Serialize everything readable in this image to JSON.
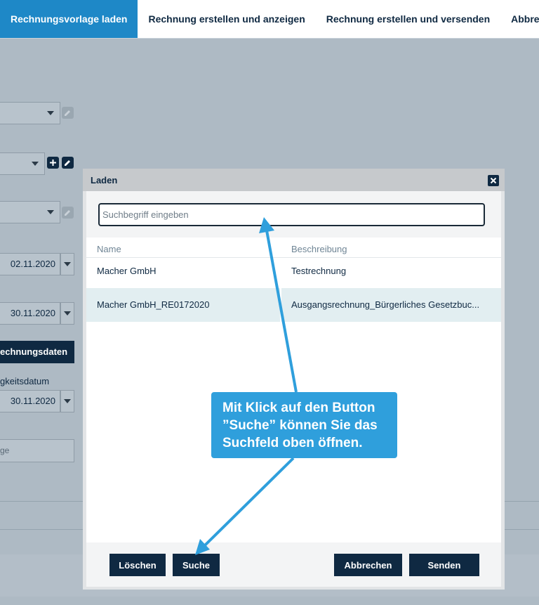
{
  "tabs": [
    {
      "label": "Rechnungsvorlage laden",
      "active": true
    },
    {
      "label": "Rechnung erstellen und anzeigen",
      "active": false
    },
    {
      "label": "Rechnung erstellen und versenden",
      "active": false
    },
    {
      "label": "Abbrechen",
      "active": false
    }
  ],
  "background": {
    "date1": "02.11.2020",
    "date2": "30.11.2020",
    "date3": "30.11.2020",
    "dark_button_label": "echnungsdaten",
    "date_field_label": "gkeitsdatum",
    "input_fragment": "ge"
  },
  "modal": {
    "title": "Laden",
    "search": {
      "placeholder": "Suchbegriff eingeben",
      "value": ""
    },
    "columns": [
      "Name",
      "Beschreibung"
    ],
    "rows": [
      {
        "name": "Macher GmbH",
        "description": "Testrechnung"
      },
      {
        "name": "Macher GmbH_RE0172020",
        "description": "Ausgangsrechnung_Bürgerliches Gesetzbuc..."
      }
    ],
    "buttons": {
      "delete": "Löschen",
      "search": "Suche",
      "cancel": "Abbrechen",
      "send": "Senden"
    }
  },
  "callout": {
    "text": "Mit Klick auf den Button ”Suche” können Sie das Suchfeld oben öffnen."
  },
  "colors": {
    "accent": "#1e88c7",
    "navy": "#0f2942",
    "callout": "#2f9fdc",
    "overlay": "#aebac4"
  }
}
